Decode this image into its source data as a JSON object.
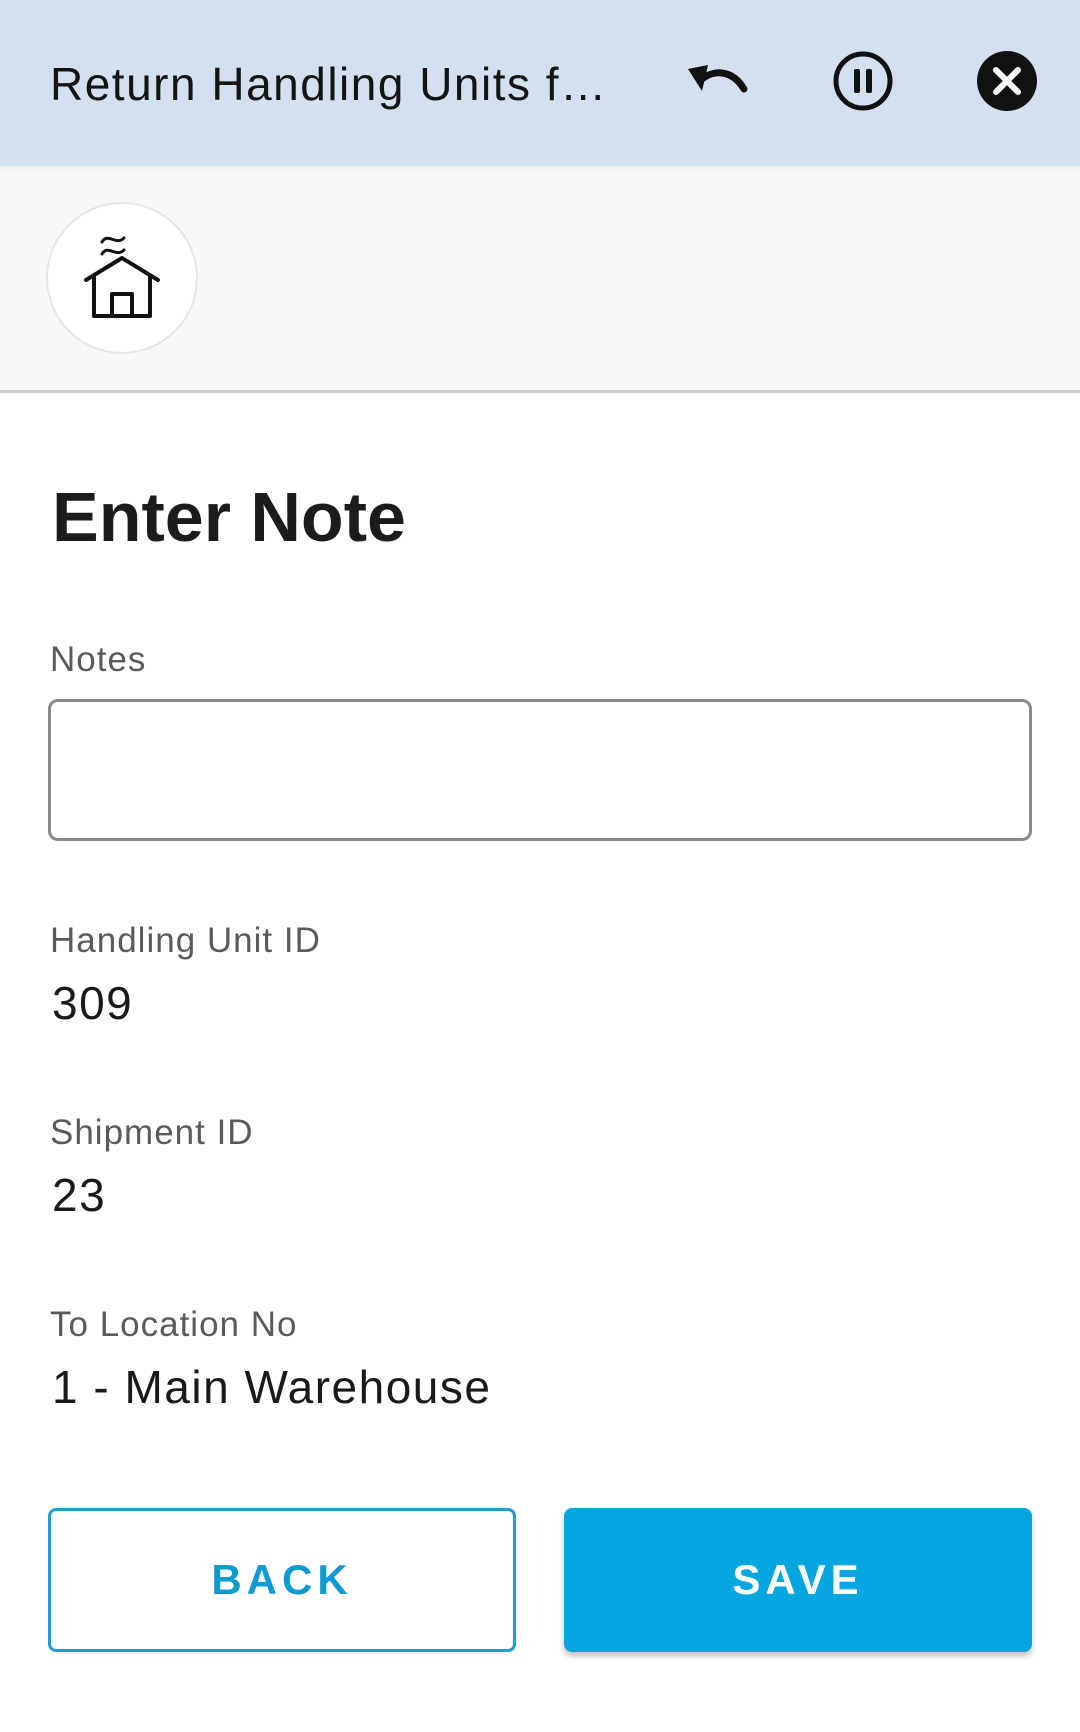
{
  "header": {
    "title": "Return Handling Units f…",
    "undo_icon": "undo-icon",
    "pause_icon": "pause-icon",
    "close_icon": "close-icon",
    "background_color": "#d3e0ef"
  },
  "subheader": {
    "home_icon": "home-icon"
  },
  "main": {
    "title": "Enter Note",
    "notes": {
      "label": "Notes",
      "value": "",
      "placeholder": ""
    },
    "handling_unit": {
      "label": "Handling Unit ID",
      "value": "309"
    },
    "shipment": {
      "label": "Shipment ID",
      "value": "23"
    },
    "to_location": {
      "label": "To Location No",
      "value": "1 - Main Warehouse"
    }
  },
  "actions": {
    "back_label": "BACK",
    "save_label": "SAVE",
    "accent_color": "#04a6e0"
  }
}
